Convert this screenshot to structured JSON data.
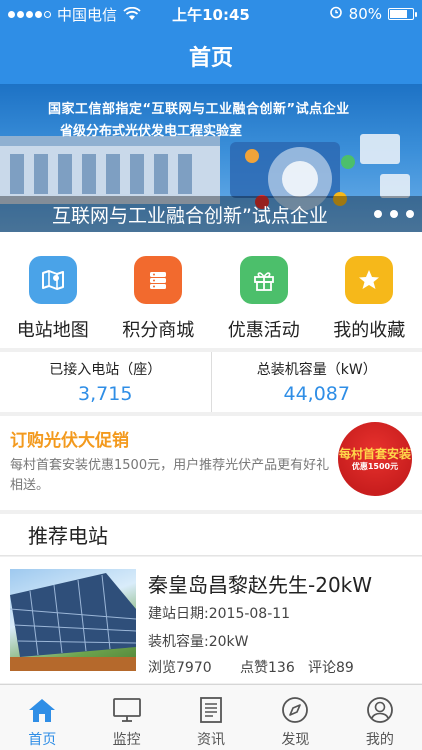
{
  "status": {
    "carrier": "中国电信",
    "time": "上午10:45",
    "battery": "80%",
    "battery_level": 0.8
  },
  "header": {
    "title": "首页"
  },
  "banner": {
    "line1": "国家工信部指定“互联网与工业融合创新”试点企业",
    "line2": "省级分布式光伏发电工程实验室",
    "caption": "互联网与工业融合创新”试点企业"
  },
  "quick": [
    {
      "label": "电站地图",
      "icon": "map-icon",
      "color": "#4aa3e8"
    },
    {
      "label": "积分商城",
      "icon": "store-icon",
      "color": "#f26a2e"
    },
    {
      "label": "优惠活动",
      "icon": "gift-icon",
      "color": "#4cbf6b"
    },
    {
      "label": "我的收藏",
      "icon": "star-icon",
      "color": "#f6b81a"
    }
  ],
  "stats": [
    {
      "label": "已接入电站（座）",
      "value": "3,715"
    },
    {
      "label": "总装机容量（kW）",
      "value": "44,087"
    }
  ],
  "promo": {
    "title": "订购光伏大促销",
    "desc": "每村首套安装优惠1500元，用户推荐光伏产品更有好礼相送。",
    "badge_line1": "每村首套安装",
    "badge_line2": "优惠1500元"
  },
  "recommend": {
    "title": "推荐电站"
  },
  "station": {
    "name": "秦皇岛昌黎赵先生-20kW",
    "built": "建站日期:2015-08-11",
    "capacity": "装机容量:20kW",
    "views": "浏览7970",
    "likes": "点赞136",
    "comments": "评论89"
  },
  "tabs": [
    {
      "label": "首页",
      "icon": "home-icon",
      "active": true
    },
    {
      "label": "监控",
      "icon": "monitor-icon",
      "active": false
    },
    {
      "label": "资讯",
      "icon": "news-icon",
      "active": false
    },
    {
      "label": "发现",
      "icon": "compass-icon",
      "active": false
    },
    {
      "label": "我的",
      "icon": "user-icon",
      "active": false
    }
  ],
  "colors": {
    "primary": "#2f8ee6",
    "promo": "#f39a1e"
  }
}
